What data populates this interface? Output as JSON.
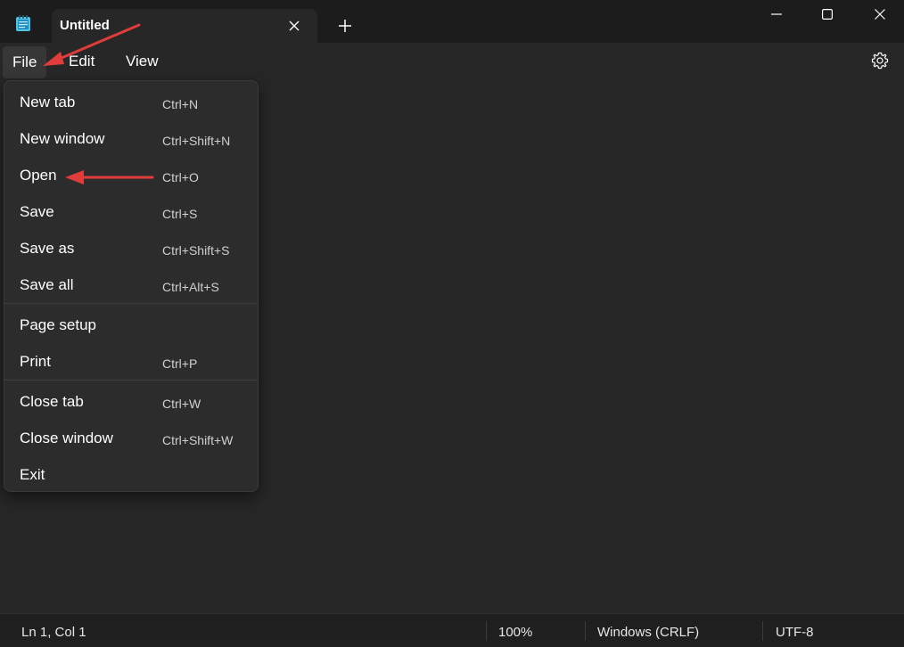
{
  "window": {
    "tab_title": "Untitled"
  },
  "icons": {
    "app": "notepad-icon",
    "tab_close": "close-icon",
    "new_tab": "plus-icon",
    "minimize": "minimize-icon",
    "maximize": "maximize-icon",
    "close": "close-icon",
    "settings": "gear-icon"
  },
  "menubar": {
    "file": "File",
    "edit": "Edit",
    "view": "View"
  },
  "file_menu": {
    "items": [
      {
        "label": "New tab",
        "shortcut": "Ctrl+N"
      },
      {
        "label": "New window",
        "shortcut": "Ctrl+Shift+N"
      },
      {
        "label": "Open",
        "shortcut": "Ctrl+O"
      },
      {
        "label": "Save",
        "shortcut": "Ctrl+S"
      },
      {
        "label": "Save as",
        "shortcut": "Ctrl+Shift+S"
      },
      {
        "label": "Save all",
        "shortcut": "Ctrl+Alt+S"
      },
      {
        "label": "Page setup",
        "shortcut": ""
      },
      {
        "label": "Print",
        "shortcut": "Ctrl+P"
      },
      {
        "label": "Close tab",
        "shortcut": "Ctrl+W"
      },
      {
        "label": "Close window",
        "shortcut": "Ctrl+Shift+W"
      },
      {
        "label": "Exit",
        "shortcut": ""
      }
    ]
  },
  "statusbar": {
    "position": "Ln 1, Col 1",
    "zoom": "100%",
    "line_ending": "Windows (CRLF)",
    "encoding": "UTF-8"
  },
  "colors": {
    "background": "#272727",
    "titlebar": "#1c1c1c",
    "menu_bg": "#2c2c2c",
    "annotation_arrow": "#e03c3c"
  }
}
